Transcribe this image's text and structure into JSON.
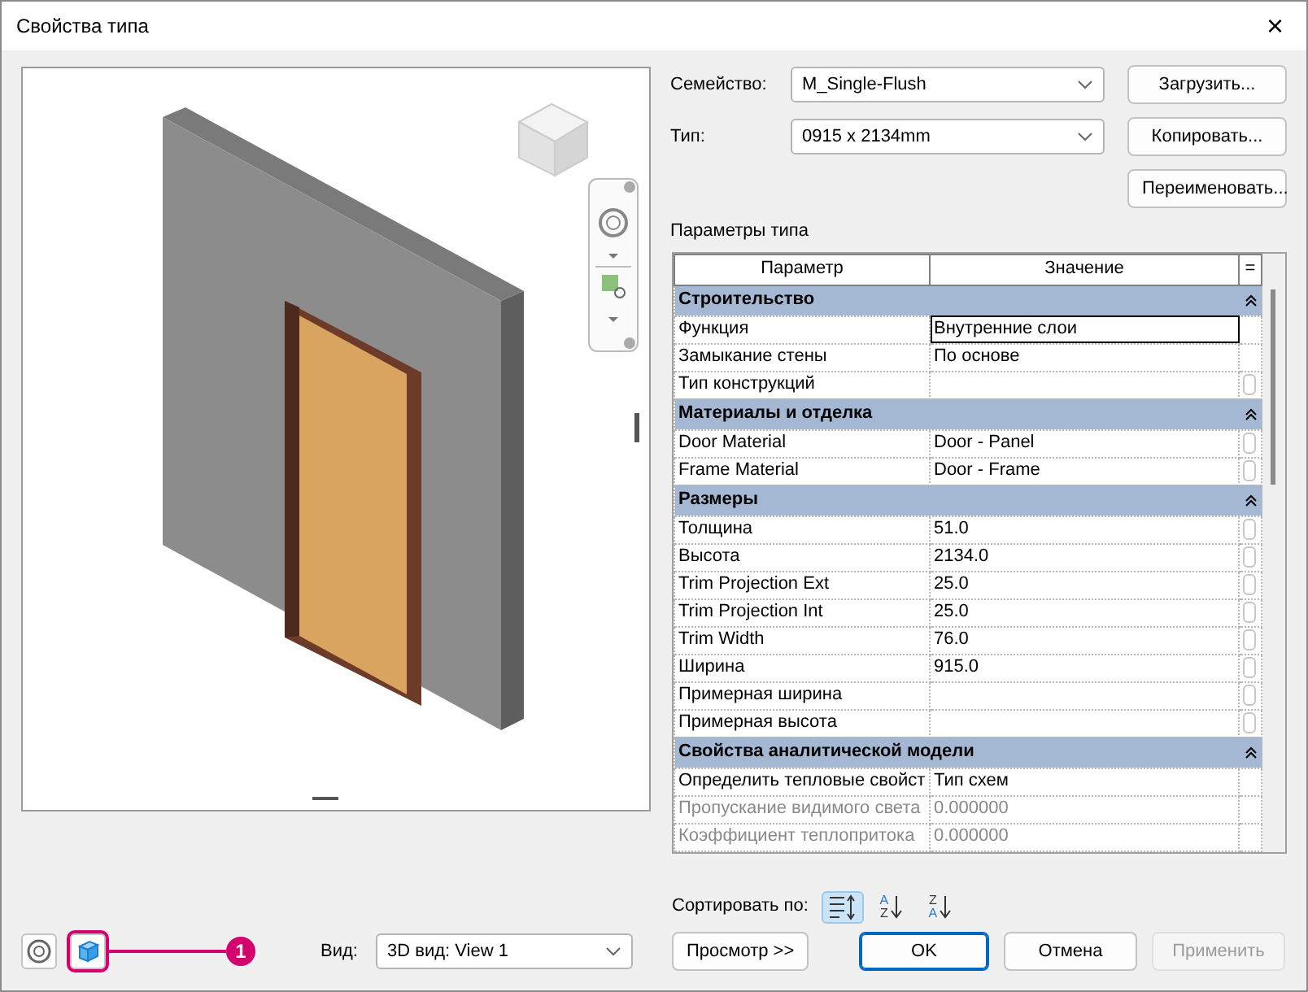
{
  "window": {
    "title": "Свойства типа",
    "close": "×"
  },
  "family": {
    "label": "Семейство:",
    "value": "M_Single-Flush"
  },
  "type": {
    "label": "Тип:",
    "value": "0915 x 2134mm"
  },
  "side_buttons": [
    "Загрузить...",
    "Копировать...",
    "Переименовать..."
  ],
  "params_title": "Параметры типа",
  "table": {
    "columns": [
      "Параметр",
      "Значение",
      "="
    ],
    "groups": [
      {
        "name": "Строительство",
        "expanded": true,
        "rows": [
          {
            "name": "Функция",
            "value": "Внутренние слои",
            "selected": true,
            "disabled": false,
            "link_button": false
          },
          {
            "name": "Замыкание стены",
            "value": "По основе",
            "selected": false,
            "disabled": false,
            "link_button": false
          },
          {
            "name": "Тип конструкций",
            "value": "",
            "selected": false,
            "disabled": false,
            "link_button": true
          }
        ]
      },
      {
        "name": "Материалы и отделка",
        "expanded": true,
        "rows": [
          {
            "name": "Door Material",
            "value": "Door - Panel",
            "selected": false,
            "disabled": false,
            "link_button": true
          },
          {
            "name": "Frame Material",
            "value": "Door - Frame",
            "selected": false,
            "disabled": false,
            "link_button": true
          }
        ]
      },
      {
        "name": "Размеры",
        "expanded": true,
        "rows": [
          {
            "name": "Толщина",
            "value": "51.0",
            "selected": false,
            "disabled": false,
            "link_button": true
          },
          {
            "name": "Высота",
            "value": "2134.0",
            "selected": false,
            "disabled": false,
            "link_button": true
          },
          {
            "name": "Trim Projection Ext",
            "value": "25.0",
            "selected": false,
            "disabled": false,
            "link_button": true
          },
          {
            "name": "Trim Projection Int",
            "value": "25.0",
            "selected": false,
            "disabled": false,
            "link_button": true
          },
          {
            "name": "Trim Width",
            "value": "76.0",
            "selected": false,
            "disabled": false,
            "link_button": true
          },
          {
            "name": "Ширина",
            "value": "915.0",
            "selected": false,
            "disabled": false,
            "link_button": true
          },
          {
            "name": "Примерная ширина",
            "value": "",
            "selected": false,
            "disabled": false,
            "link_button": true
          },
          {
            "name": "Примерная высота",
            "value": "",
            "selected": false,
            "disabled": false,
            "link_button": true
          }
        ]
      },
      {
        "name": "Свойства аналитической модели",
        "expanded": true,
        "rows": [
          {
            "name": "Определить тепловые свойст",
            "value": "Тип схем",
            "selected": false,
            "disabled": false,
            "link_button": false
          },
          {
            "name": "Пропускание видимого света",
            "value": "0.000000",
            "selected": false,
            "disabled": true,
            "link_button": false
          },
          {
            "name": "Коэффициент теплопритока",
            "value": "0.000000",
            "selected": false,
            "disabled": true,
            "link_button": false
          }
        ]
      }
    ]
  },
  "sort": {
    "label": "Сортировать по:",
    "options": [
      {
        "kind": "grouped",
        "selected": true
      },
      {
        "kind": "alpha",
        "top": "A",
        "bottom": "Z",
        "selected": false
      },
      {
        "kind": "alpha",
        "top": "Z",
        "bottom": "A",
        "selected": false
      }
    ]
  },
  "view": {
    "label": "Вид:",
    "value": "3D вид: View 1"
  },
  "preview_modes": [
    {
      "kind": "steering",
      "selected": false
    },
    {
      "kind": "cube",
      "selected": true
    }
  ],
  "callout": "1",
  "buttons": [
    {
      "label": "Просмотр >>",
      "kind": "default",
      "disabled": false
    },
    {
      "label": "OK",
      "kind": "primary",
      "disabled": false
    },
    {
      "label": "Отмена",
      "kind": "default",
      "disabled": false
    },
    {
      "label": "Применить",
      "kind": "default",
      "disabled": true
    }
  ]
}
